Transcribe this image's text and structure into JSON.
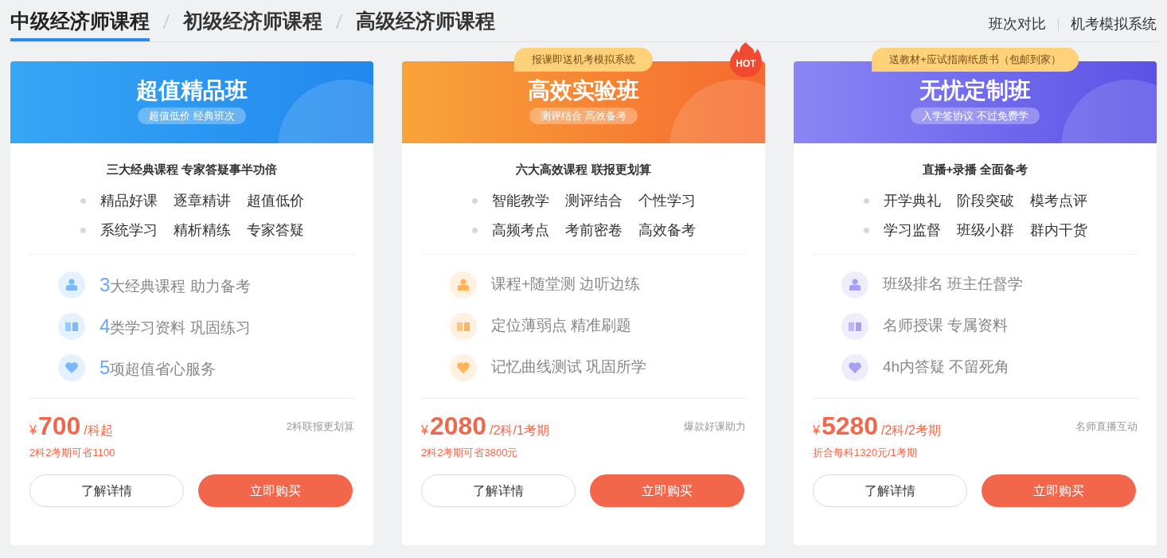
{
  "tabs": [
    {
      "label": "中级经济师课程",
      "selected": true
    },
    {
      "label": "初级经济师课程",
      "selected": false
    },
    {
      "label": "高级经济师课程",
      "selected": false
    }
  ],
  "header_links": [
    "班次对比",
    "机考模拟系统"
  ],
  "cards": [
    {
      "kind": "blue",
      "title": "超值精品班",
      "subtitle": "超值低价 经典班次",
      "heading": "三大经典课程 专家答疑事半功倍",
      "bullet_rows": [
        [
          "精品好课",
          "逐章精讲",
          "超值低价"
        ],
        [
          "系统学习",
          "精析精练",
          "专家答疑"
        ]
      ],
      "features": [
        {
          "kind": "person",
          "number": "3",
          "text": "大经典课程 助力备考"
        },
        {
          "kind": "book",
          "number": "4",
          "text": "类学习资料 巩固练习"
        },
        {
          "kind": "heart",
          "number": "5",
          "text": "项超值省心服务"
        }
      ],
      "price": {
        "currency": "¥",
        "amount": "700",
        "unit": "/科起",
        "note": "2科联报更划算",
        "saving": "2科2考期可省1100"
      },
      "buttons": [
        "了解详情",
        "立即购买"
      ]
    },
    {
      "kind": "orange",
      "title": "高效实验班",
      "subtitle": "测评结合 高效备考",
      "hot_badge": "HOT",
      "ribbon": "报课即送机考模拟系统",
      "heading": "六大高效课程 联报更划算",
      "bullet_rows": [
        [
          "智能教学",
          "测评结合",
          "个性学习"
        ],
        [
          "高频考点",
          "考前密卷",
          "高效备考"
        ]
      ],
      "features": [
        {
          "kind": "person",
          "text": "课程+随堂测 边听边练"
        },
        {
          "kind": "book",
          "text": "定位薄弱点 精准刷题"
        },
        {
          "kind": "heart",
          "text": "记忆曲线测试 巩固所学"
        }
      ],
      "price": {
        "currency": "¥",
        "amount": "2080",
        "unit": "/2科/1考期",
        "note": "爆款好课助力",
        "saving": "2科2考期可省3800元"
      },
      "buttons": [
        "了解详情",
        "立即购买"
      ]
    },
    {
      "kind": "purple",
      "title": "无忧定制班",
      "subtitle": "入学签协议 不过免费学",
      "ribbon": "送教材+应试指南纸质书（包邮到家）",
      "heading": "直播+录播 全面备考",
      "bullet_rows": [
        [
          "开学典礼",
          "阶段突破",
          "模考点评"
        ],
        [
          "学习监督",
          "班级小群",
          "群内干货"
        ]
      ],
      "features": [
        {
          "kind": "person",
          "text": "班级排名 班主任督学"
        },
        {
          "kind": "book",
          "text": "名师授课 专属资料"
        },
        {
          "kind": "heart",
          "text": "4h内答疑 不留死角"
        }
      ],
      "price": {
        "currency": "¥",
        "amount": "5280",
        "unit": "/2科/2考期",
        "note": "名师直播互动",
        "saving": "折合每科1320元/1考期"
      },
      "buttons": [
        "了解详情",
        "立即购买"
      ]
    }
  ]
}
